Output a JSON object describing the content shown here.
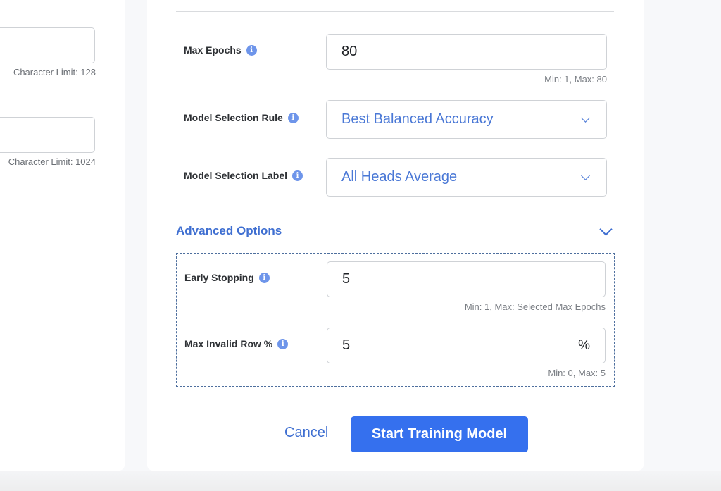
{
  "left_panel": {
    "fields": [
      {
        "value": "",
        "hint": "Character Limit: 128"
      },
      {
        "value": "",
        "hint": "Character Limit: 1024"
      }
    ]
  },
  "form": {
    "max_epochs": {
      "label": "Max Epochs",
      "value": "80",
      "hint": "Min: 1, Max: 80"
    },
    "model_selection_rule": {
      "label": "Model Selection Rule",
      "value": "Best Balanced Accuracy"
    },
    "model_selection_label": {
      "label": "Model Selection Label",
      "value": "All Heads Average"
    },
    "advanced": {
      "title": "Advanced Options",
      "expanded": true,
      "early_stopping": {
        "label": "Early Stopping",
        "value": "5",
        "hint": "Min: 1, Max: Selected Max Epochs"
      },
      "max_invalid_row": {
        "label": "Max Invalid Row %",
        "value": "5",
        "suffix": "%",
        "hint": "Min: 0, Max: 5"
      }
    }
  },
  "icons": {
    "info": "i"
  },
  "actions": {
    "cancel_label": "Cancel",
    "submit_label": "Start Training Model"
  },
  "colors": {
    "accent": "#3570ee",
    "link": "#3f6fd1",
    "info_icon": "#6e95ea"
  }
}
